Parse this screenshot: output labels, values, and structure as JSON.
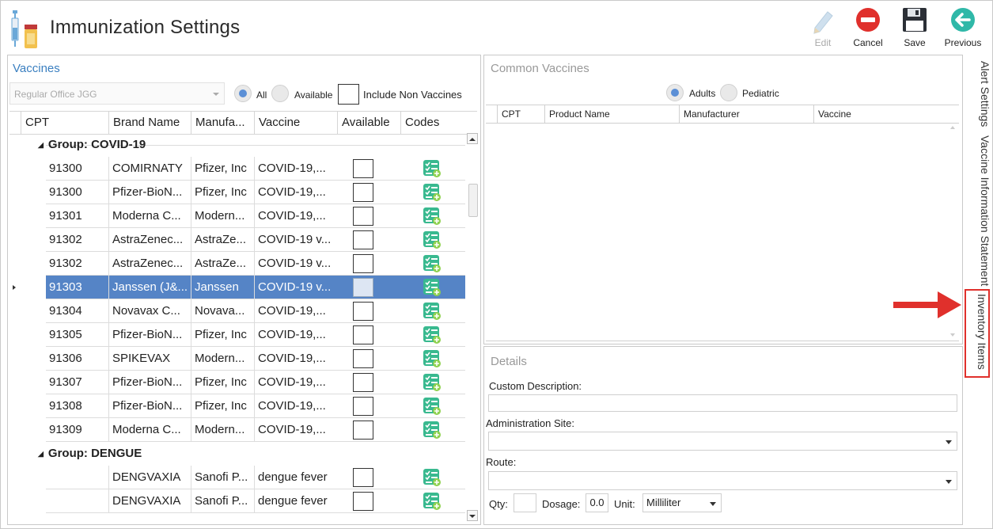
{
  "window": {
    "title": "Immunization Settings",
    "icon": "syringe-vial-icon"
  },
  "toolbar": {
    "edit_label": "Edit",
    "cancel_label": "Cancel",
    "save_label": "Save",
    "previous_label": "Previous",
    "cancel_color": "#e0302c",
    "previous_color": "#2fb8a8"
  },
  "vaccines": {
    "title": "Vaccines",
    "office_select_value": "Regular Office JGG",
    "filter_all_label": "All",
    "filter_available_label": "Available",
    "include_non_vaccines_label": "Include Non Vaccines",
    "selected_filter": "All",
    "columns": [
      "CPT",
      "Brand Name",
      "Manufa...",
      "Vaccine",
      "Available",
      "Codes"
    ],
    "groups": [
      {
        "label": "Group: COVID-19",
        "rows": [
          {
            "cpt": "91300",
            "brand": "COMIRNATY",
            "manufacturer": "Pfizer, Inc",
            "vaccine": "COVID-19,...",
            "selected": false
          },
          {
            "cpt": "91300",
            "brand": "Pfizer-BioN...",
            "manufacturer": "Pfizer, Inc",
            "vaccine": "COVID-19,...",
            "selected": false
          },
          {
            "cpt": "91301",
            "brand": "Moderna C...",
            "manufacturer": "Modern...",
            "vaccine": "COVID-19,...",
            "selected": false
          },
          {
            "cpt": "91302",
            "brand": "AstraZenec...",
            "manufacturer": "AstraZe...",
            "vaccine": "COVID-19 v...",
            "selected": false
          },
          {
            "cpt": "91302",
            "brand": "AstraZenec...",
            "manufacturer": "AstraZe...",
            "vaccine": "COVID-19 v...",
            "selected": false
          },
          {
            "cpt": "91303",
            "brand": "Janssen (J&...",
            "manufacturer": "Janssen",
            "vaccine": "COVID-19 v...",
            "selected": true
          },
          {
            "cpt": "91304",
            "brand": "Novavax C...",
            "manufacturer": "Novava...",
            "vaccine": "COVID-19,...",
            "selected": false
          },
          {
            "cpt": "91305",
            "brand": "Pfizer-BioN...",
            "manufacturer": "Pfizer, Inc",
            "vaccine": "COVID-19,...",
            "selected": false
          },
          {
            "cpt": "91306",
            "brand": "SPIKEVAX",
            "manufacturer": "Modern...",
            "vaccine": "COVID-19,...",
            "selected": false
          },
          {
            "cpt": "91307",
            "brand": "Pfizer-BioN...",
            "manufacturer": "Pfizer, Inc",
            "vaccine": "COVID-19,...",
            "selected": false
          },
          {
            "cpt": "91308",
            "brand": "Pfizer-BioN...",
            "manufacturer": "Pfizer, Inc",
            "vaccine": "COVID-19,...",
            "selected": false
          },
          {
            "cpt": "91309",
            "brand": "Moderna C...",
            "manufacturer": "Modern...",
            "vaccine": "COVID-19,...",
            "selected": false
          }
        ]
      },
      {
        "label": "Group: DENGUE",
        "rows": [
          {
            "cpt": "",
            "brand": "DENGVAXIA",
            "manufacturer": "Sanofi P...",
            "vaccine": "dengue fever",
            "selected": false
          },
          {
            "cpt": "",
            "brand": "DENGVAXIA",
            "manufacturer": "Sanofi P...",
            "vaccine": "dengue fever",
            "selected": false
          }
        ]
      }
    ],
    "codes_icon": "checklist-add-icon",
    "selected_row_color": "#5584c6"
  },
  "common_vaccines": {
    "title": "Common Vaccines",
    "adults_label": "Adults",
    "pediatric_label": "Pediatric",
    "selected_filter": "Adults",
    "columns": [
      "CPT",
      "Product Name",
      "Manufacturer",
      "Vaccine"
    ]
  },
  "details": {
    "title": "Details",
    "custom_description_label": "Custom Description:",
    "custom_description_value": "",
    "administration_site_label": "Administration Site:",
    "administration_site_value": "",
    "route_label": "Route:",
    "route_value": "",
    "qty_label": "Qty:",
    "qty_value": "",
    "dosage_label": "Dosage:",
    "dosage_value": "0.0",
    "unit_label": "Unit:",
    "unit_value": "Milliliter"
  },
  "side_tabs": {
    "alert_settings": "Alert Settings",
    "vaccine_information_statement": "Vaccine Information Statement",
    "inventory_items": "Inventory Items",
    "highlight_color": "#e0302c"
  }
}
